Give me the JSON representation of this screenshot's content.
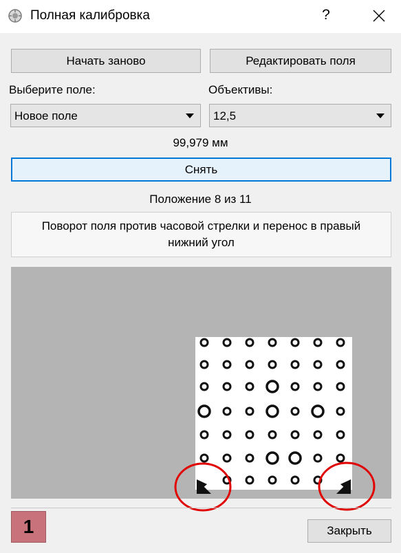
{
  "window": {
    "title": "Полная калибровка",
    "help_label": "?",
    "icons": {
      "app": "calibration-app-icon",
      "close": "close-icon"
    }
  },
  "toolbar": {
    "restart_label": "Начать заново",
    "edit_fields_label": "Редактировать поля"
  },
  "field_select": {
    "label": "Выберите поле:",
    "value": "Новое поле"
  },
  "lens_select": {
    "label": "Объективы:",
    "value": "12,5"
  },
  "measurement": "99,979 мм",
  "capture_label": "Снять",
  "position_text": "Положение 8 из 11",
  "instruction": "Поворот поля против часовой стрелки и перенос в правый нижний угол",
  "badge": "1",
  "close_label": "Закрыть",
  "colors": {
    "accent": "#0078d7",
    "annotation_circle": "#e00000",
    "badge": "#c8737c",
    "preview_bg": "#b4b4b4"
  }
}
